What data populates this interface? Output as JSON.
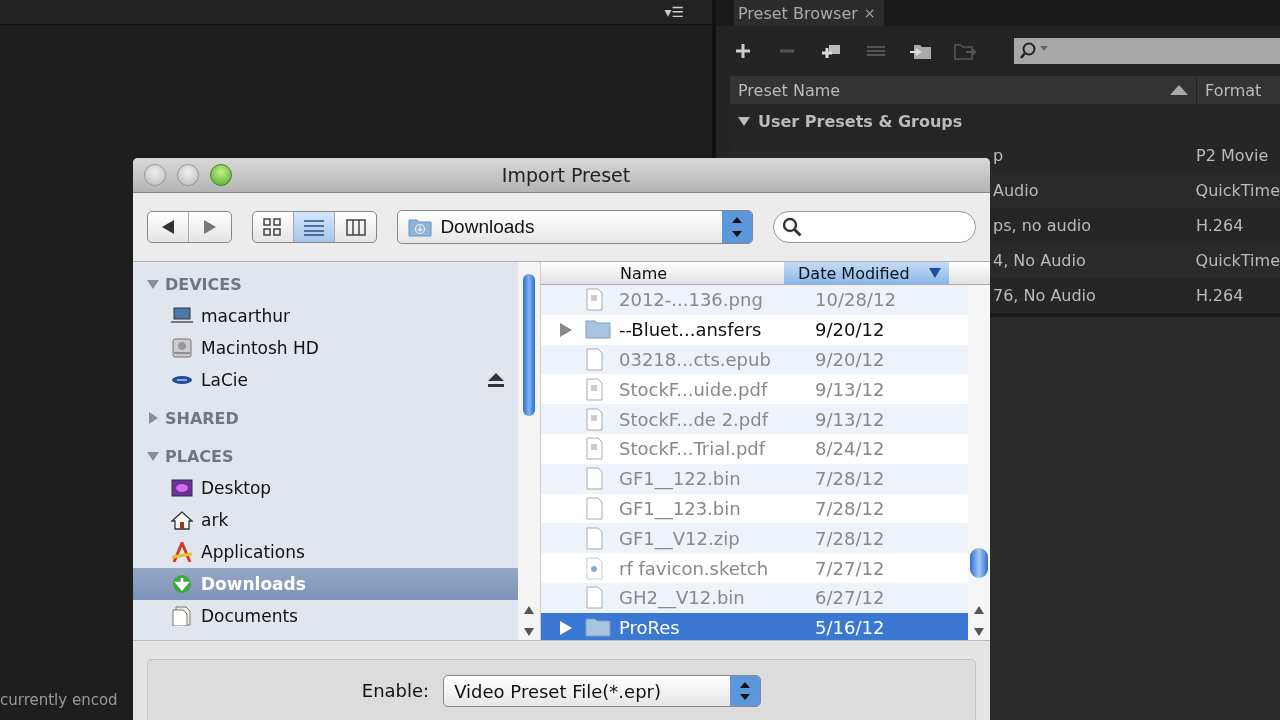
{
  "queue_panel": {
    "menu_glyph": "▾☰",
    "status_text": "currently encod"
  },
  "preset_browser": {
    "tab": {
      "label": "Preset Browser",
      "close": "×"
    },
    "columns": [
      {
        "label": "Preset Name",
        "sorted": true
      },
      {
        "label": "Format",
        "sorted": false
      }
    ],
    "group": {
      "label": "User Presets & Groups",
      "expanded": true
    },
    "rows": [
      {
        "name": "p",
        "format": "P2 Movie",
        "covered": true
      },
      {
        "name": "Audio",
        "format": "QuickTime",
        "covered": true
      },
      {
        "name": "ps, no audio",
        "format": "H.264",
        "covered": true
      },
      {
        "name": "4, No Audio",
        "format": "QuickTime",
        "covered": true
      },
      {
        "name": "76, No Audio",
        "format": "H.264",
        "covered": true
      }
    ]
  },
  "dialog": {
    "title": "Import Preset",
    "view_modes": [
      {
        "kind": "icons",
        "selected": false
      },
      {
        "kind": "list",
        "selected": true
      },
      {
        "kind": "columns",
        "selected": false
      }
    ],
    "location": "Downloads",
    "sidebar": [
      {
        "label": "DEVICES",
        "expanded": true,
        "items": [
          {
            "label": "macarthur",
            "kind": "laptop",
            "selected": false,
            "ejectable": false
          },
          {
            "label": "Macintosh HD",
            "kind": "disk",
            "selected": false,
            "ejectable": false
          },
          {
            "label": "LaCie",
            "kind": "external",
            "selected": false,
            "ejectable": true
          }
        ]
      },
      {
        "label": "SHARED",
        "expanded": false
      },
      {
        "label": "PLACES",
        "expanded": true,
        "items": [
          {
            "label": "Desktop",
            "kind": "desktop",
            "selected": false,
            "ejectable": false
          },
          {
            "label": "ark",
            "kind": "home",
            "selected": false,
            "ejectable": false
          },
          {
            "label": "Applications",
            "kind": "apps",
            "selected": false,
            "ejectable": false
          },
          {
            "label": "Downloads",
            "kind": "downloads",
            "selected": true,
            "ejectable": false
          },
          {
            "label": "Documents",
            "kind": "documents",
            "selected": false,
            "ejectable": false
          }
        ]
      }
    ],
    "columns": [
      {
        "label": "Name",
        "sorted": false
      },
      {
        "label": "Date Modified",
        "sorted": true
      }
    ],
    "files": [
      {
        "name": "2012-...136.png",
        "date": "10/28/12",
        "kind": "doc",
        "disabled": true,
        "selected": false
      },
      {
        "name": "--Bluet...ansfers",
        "date": "9/20/12",
        "kind": "folder",
        "disabled": false,
        "selected": false
      },
      {
        "name": "03218...cts.epub",
        "date": "9/20/12",
        "kind": "blank",
        "disabled": true,
        "selected": false
      },
      {
        "name": "StockF...uide.pdf",
        "date": "9/13/12",
        "kind": "doc",
        "disabled": true,
        "selected": false
      },
      {
        "name": "StockF...de 2.pdf",
        "date": "9/13/12",
        "kind": "doc",
        "disabled": true,
        "selected": false
      },
      {
        "name": "StockF...Trial.pdf",
        "date": "8/24/12",
        "kind": "doc",
        "disabled": true,
        "selected": false
      },
      {
        "name": "GF1__122.bin",
        "date": "7/28/12",
        "kind": "blank",
        "disabled": true,
        "selected": false
      },
      {
        "name": "GF1__123.bin",
        "date": "7/28/12",
        "kind": "blank",
        "disabled": true,
        "selected": false
      },
      {
        "name": "GF1__V12.zip",
        "date": "7/28/12",
        "kind": "blank",
        "disabled": true,
        "selected": false
      },
      {
        "name": "rf favicon.sketch",
        "date": "7/27/12",
        "kind": "sketch",
        "disabled": true,
        "selected": false
      },
      {
        "name": "GH2__V12.bin",
        "date": "6/27/12",
        "kind": "blank",
        "disabled": true,
        "selected": false
      },
      {
        "name": "ProRes",
        "date": "5/16/12",
        "kind": "folder",
        "disabled": false,
        "selected": true
      }
    ],
    "enable": {
      "label": "Enable:",
      "value": "Video Preset File(*.epr)"
    }
  }
}
